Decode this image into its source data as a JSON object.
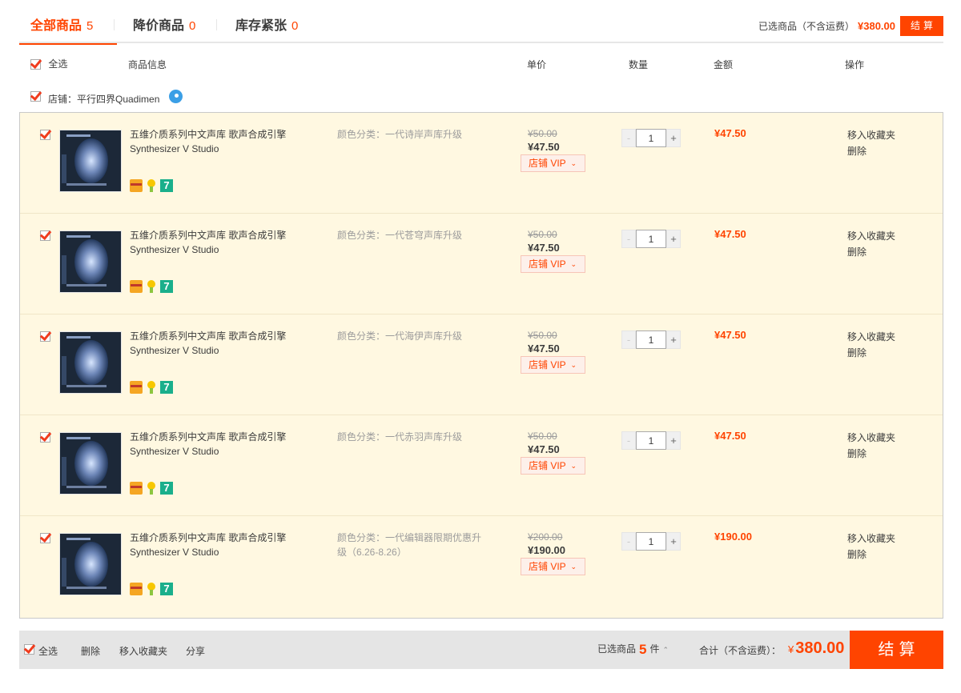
{
  "tabs": [
    {
      "label": "全部商品",
      "count": "5"
    },
    {
      "label": "降价商品",
      "count": "0"
    },
    {
      "label": "库存紧张",
      "count": "0"
    }
  ],
  "top": {
    "selected_label": "已选商品（不含运费）",
    "price": "¥380.00",
    "checkout": "结算"
  },
  "header": {
    "select_all": "全选",
    "info": "商品信息",
    "unit_price": "单价",
    "quantity": "数量",
    "amount": "金额",
    "action": "操作"
  },
  "shop": {
    "label": "店铺：平行四界Quadimen"
  },
  "items": [
    {
      "title": "五维介质系列中文声库 歌声合成引擎 Synthesizer V Studio",
      "sku": "颜色分类：一代诗岸声库升级",
      "orig_price": "¥50.00",
      "price": "¥47.50",
      "vip": "店铺 VIP",
      "qty": "1",
      "sum": "¥47.50",
      "fav": "移入收藏夹",
      "del": "删除"
    },
    {
      "title": "五维介质系列中文声库 歌声合成引擎 Synthesizer V Studio",
      "sku": "颜色分类：一代苍穹声库升级",
      "orig_price": "¥50.00",
      "price": "¥47.50",
      "vip": "店铺 VIP",
      "qty": "1",
      "sum": "¥47.50",
      "fav": "移入收藏夹",
      "del": "删除"
    },
    {
      "title": "五维介质系列中文声库 歌声合成引擎 Synthesizer V Studio",
      "sku": "颜色分类：一代海伊声库升级",
      "orig_price": "¥50.00",
      "price": "¥47.50",
      "vip": "店铺 VIP",
      "qty": "1",
      "sum": "¥47.50",
      "fav": "移入收藏夹",
      "del": "删除"
    },
    {
      "title": "五维介质系列中文声库 歌声合成引擎 Synthesizer V Studio",
      "sku": "颜色分类：一代赤羽声库升级",
      "orig_price": "¥50.00",
      "price": "¥47.50",
      "vip": "店铺 VIP",
      "qty": "1",
      "sum": "¥47.50",
      "fav": "移入收藏夹",
      "del": "删除"
    },
    {
      "title": "五维介质系列中文声库 歌声合成引擎 Synthesizer V Studio",
      "sku": "颜色分类：一代编辑器限期优惠升级（6.26-8.26）",
      "orig_price": "¥200.00",
      "price": "¥190.00",
      "vip": "店铺 VIP",
      "qty": "1",
      "sum": "¥190.00",
      "fav": "移入收藏夹",
      "del": "删除"
    }
  ],
  "footer": {
    "select_all": "全选",
    "delete": "删除",
    "move_fav": "移入收藏夹",
    "share": "分享",
    "selected_prefix": "已选商品",
    "selected_count": "5",
    "selected_suffix": "件",
    "total_label": "合计（不含运费）：",
    "currency": "¥",
    "total": "380.00",
    "checkout": "结算"
  },
  "colors": {
    "accent": "#ff4400",
    "row_bg": "#fff8e1",
    "footer_bg": "#e5e5e5"
  }
}
